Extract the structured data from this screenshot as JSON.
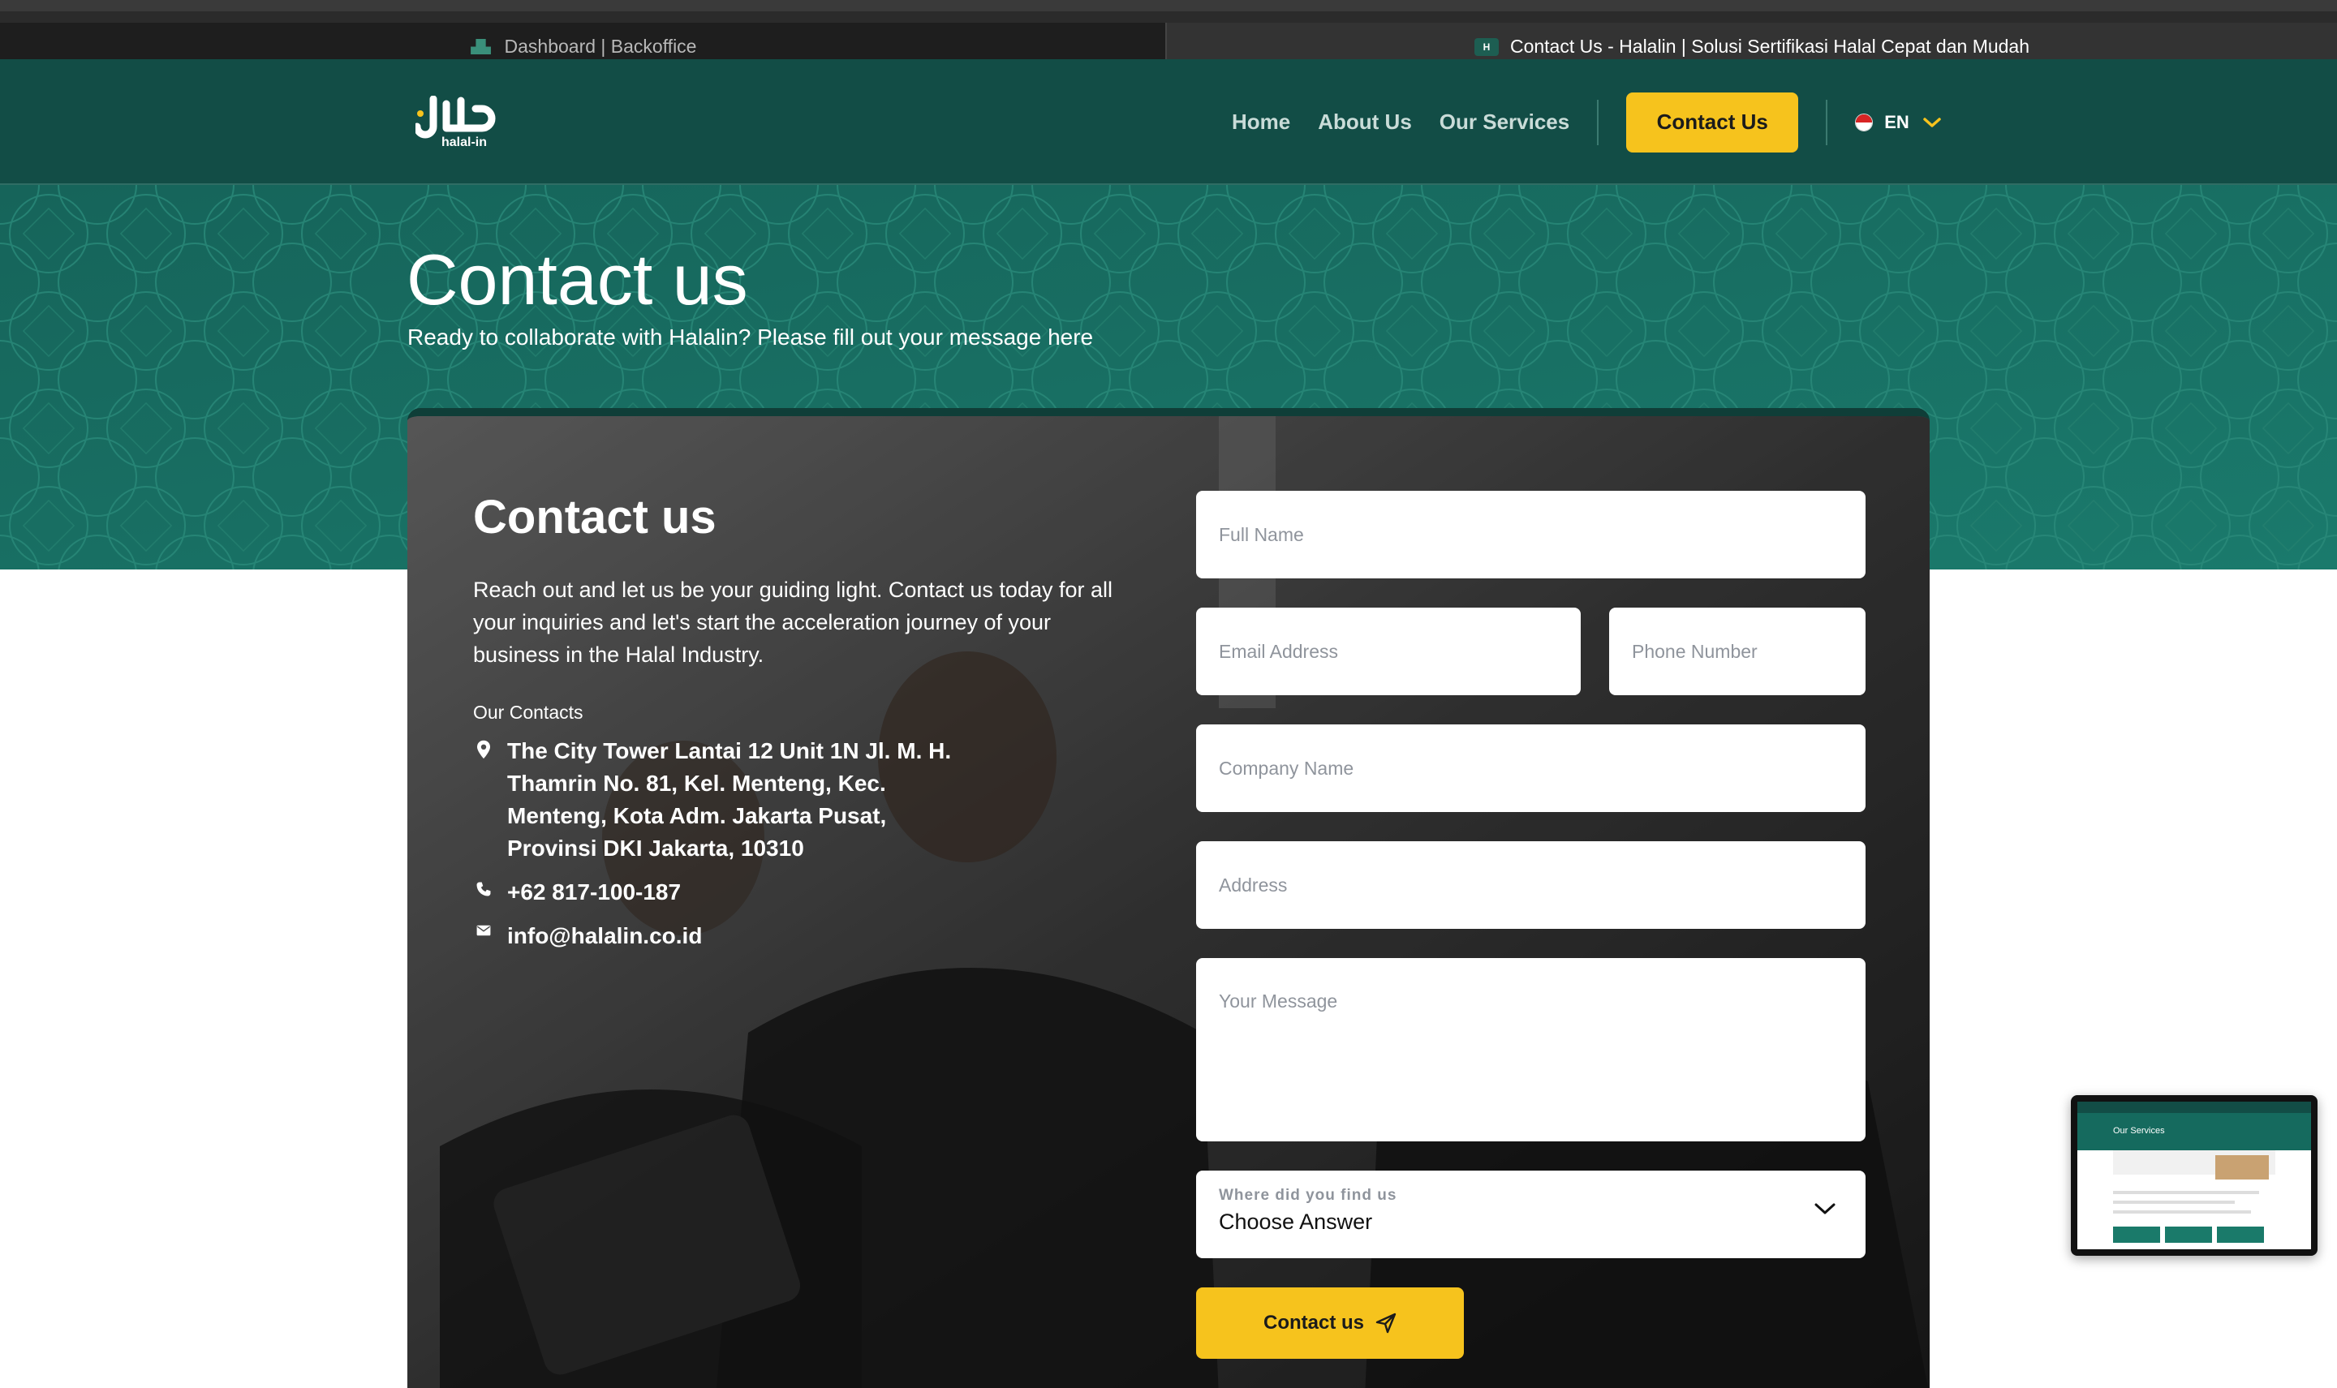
{
  "browser": {
    "tabs": [
      {
        "title": "Dashboard | Backoffice",
        "active": false
      },
      {
        "title": "Contact Us - Halalin | Solusi Sertifikasi Halal Cepat dan Mudah",
        "active": true
      }
    ]
  },
  "header": {
    "logo_text": "halal-in",
    "nav": [
      {
        "label": "Home"
      },
      {
        "label": "About Us"
      },
      {
        "label": "Our Services"
      }
    ],
    "cta_label": "Contact Us",
    "language": "EN"
  },
  "hero": {
    "title": "Contact us",
    "subtitle": "Ready to collaborate with Halalin? Please fill out your message here"
  },
  "contact_card": {
    "title": "Contact us",
    "description": "Reach out and let us be your guiding light. Contact us today for all your inquiries and let's start the acceleration journey of your business in the Halal Industry.",
    "contacts_label": "Our Contacts",
    "address": "The City Tower Lantai 12 Unit 1N Jl. M. H. Thamrin No. 81, Kel. Menteng, Kec. Menteng, Kota Adm. Jakarta Pusat, Provinsi DKI Jakarta, 10310",
    "phone": "+62 817-100-187",
    "email": "info@halalin.co.id"
  },
  "form": {
    "full_name_placeholder": "Full Name",
    "email_placeholder": "Email Address",
    "phone_placeholder": "Phone Number",
    "company_placeholder": "Company Name",
    "address_placeholder": "Address",
    "message_placeholder": "Your Message",
    "source_label": "Where did you find us",
    "source_value": "Choose Answer",
    "submit_label": "Contact us"
  },
  "preview": {
    "title": "Our Services"
  },
  "colors": {
    "header_bg": "#124d46",
    "hero_bg": "#156a5e",
    "accent": "#f6c31d"
  }
}
